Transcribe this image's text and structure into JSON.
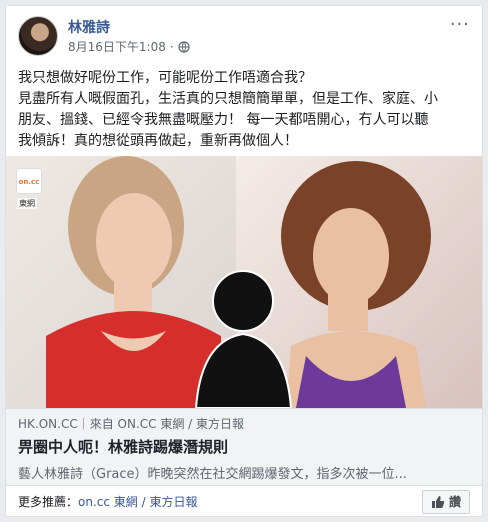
{
  "post": {
    "author": "林雅詩",
    "timestamp": "8月16日下午1:08",
    "separator": "·",
    "privacy_icon": "globe-icon",
    "more_icon": "more-icon",
    "text_lines": [
      "我只想做好呢份工作，可能呢份工作唔適合我？",
      "見盡所有人嘅假面孔，生活真的只想簡簡單單，但是工作、家庭、小",
      "朋友、搵錢、已經令我無盡嘅壓力！ 每一天都唔開心，冇人可以聽",
      "我傾訴！真的想從頭再做起，重新再做個人！"
    ]
  },
  "media": {
    "logo_text": "on.cc",
    "logo_sub": "東網"
  },
  "link": {
    "domain": "HK.ON.CC｜來自 ON.CC 東網 / 東方日報",
    "title": "畀圈中人呃！林雅詩踢爆潛規則",
    "description": "藝人林雅詩（Grace）昨晚突然在社交網踢爆發文，指多次被一位..."
  },
  "footer": {
    "more_label": "更多推薦：",
    "more_link": "on.cc 東網 / 東方日報",
    "like_label": "讚"
  },
  "colors": {
    "link_blue": "#385898",
    "secondary": "#606770",
    "background": "#e9ebee"
  }
}
